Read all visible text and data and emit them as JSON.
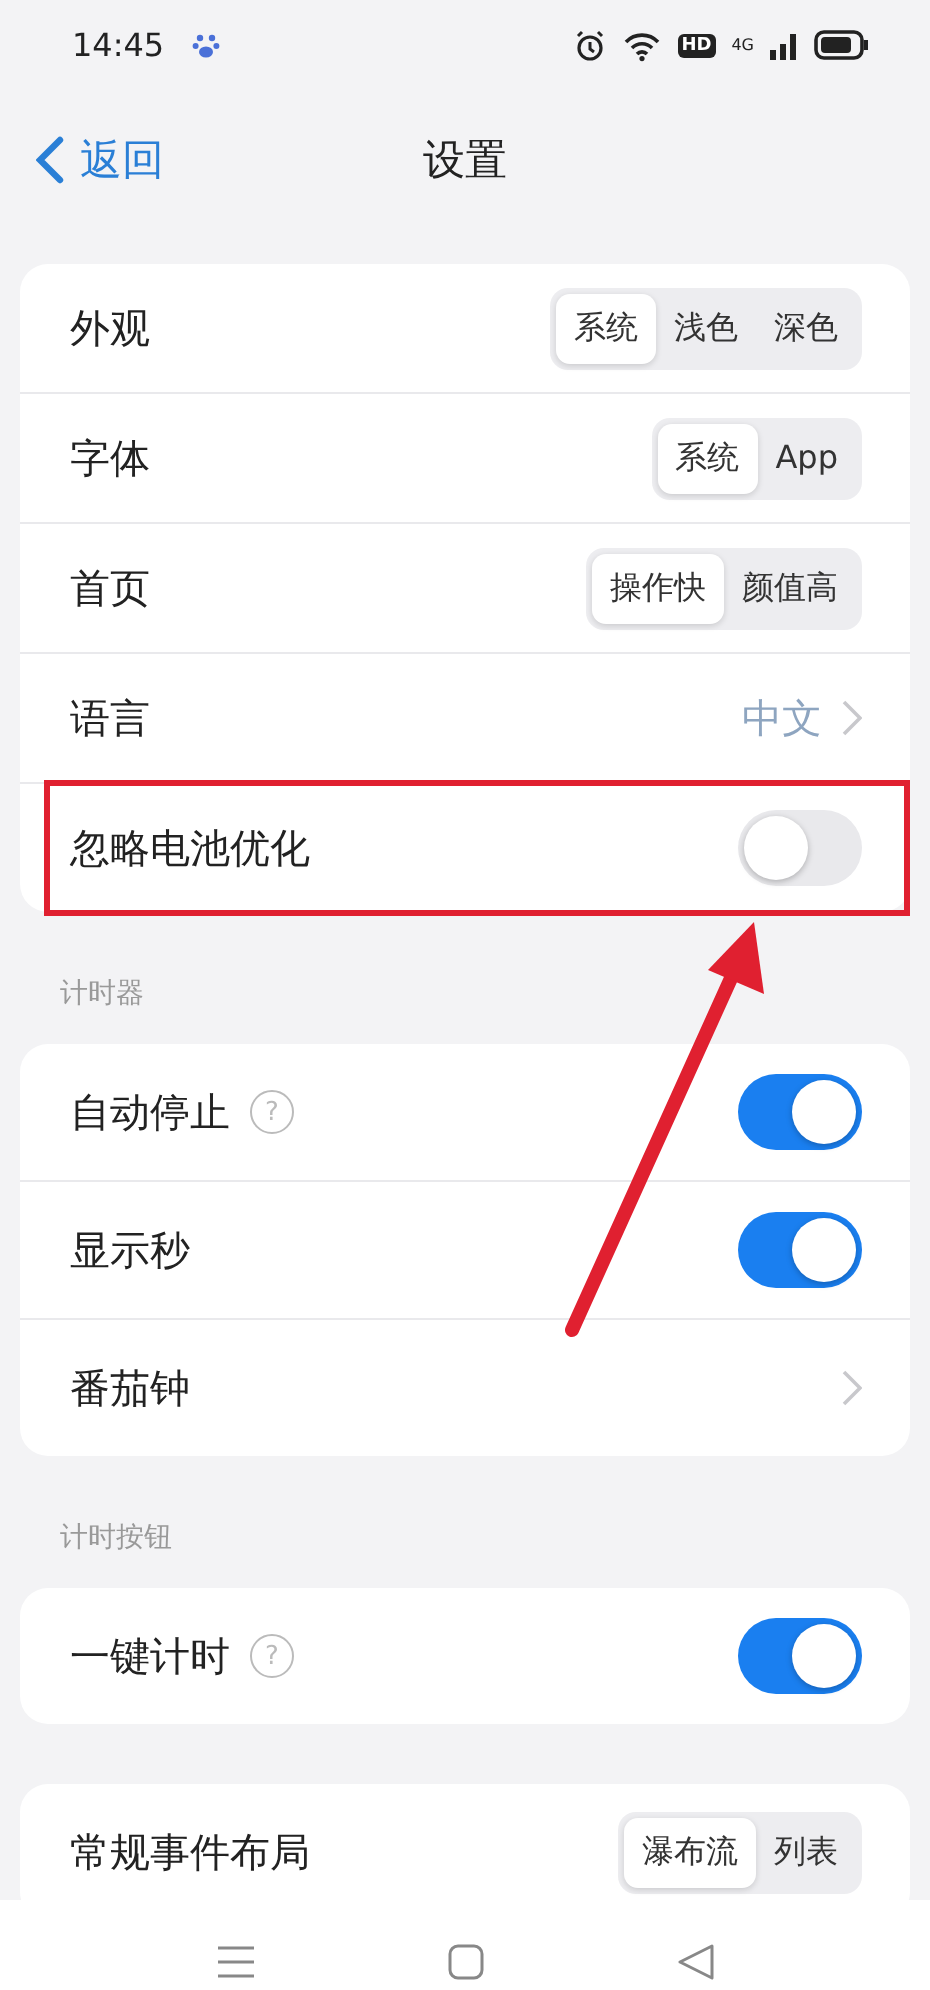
{
  "status_bar": {
    "time": "14:45",
    "hd": "HD",
    "network": "4G"
  },
  "header": {
    "back": "返回",
    "title": "设置"
  },
  "sections": [
    {
      "rows": [
        {
          "kind": "segmented",
          "label": "外观",
          "options": [
            {
              "label": "系统",
              "selected": true
            },
            {
              "label": "浅色",
              "selected": false
            },
            {
              "label": "深色",
              "selected": false
            }
          ]
        },
        {
          "kind": "segmented",
          "label": "字体",
          "options": [
            {
              "label": "系统",
              "selected": true
            },
            {
              "label": "App",
              "selected": false
            }
          ]
        },
        {
          "kind": "segmented",
          "label": "首页",
          "options": [
            {
              "label": "操作快",
              "selected": true
            },
            {
              "label": "颜值高",
              "selected": false
            }
          ]
        },
        {
          "kind": "link",
          "label": "语言",
          "value": "中文"
        },
        {
          "kind": "toggle",
          "label": "忽略电池优化",
          "on": false,
          "highlighted": true
        }
      ]
    },
    {
      "title": "计时器",
      "rows": [
        {
          "kind": "toggle",
          "label": "自动停止",
          "help": "?",
          "on": true
        },
        {
          "kind": "toggle",
          "label": "显示秒",
          "on": true
        },
        {
          "kind": "link",
          "label": "番茄钟"
        }
      ]
    },
    {
      "title": "计时按钮",
      "rows": [
        {
          "kind": "toggle",
          "label": "一键计时",
          "help": "?",
          "on": true
        }
      ]
    },
    {
      "rows": [
        {
          "kind": "segmented",
          "label": "常规事件布局",
          "options": [
            {
              "label": "瀑布流",
              "selected": true
            },
            {
              "label": "列表",
              "selected": false
            }
          ]
        }
      ]
    }
  ]
}
